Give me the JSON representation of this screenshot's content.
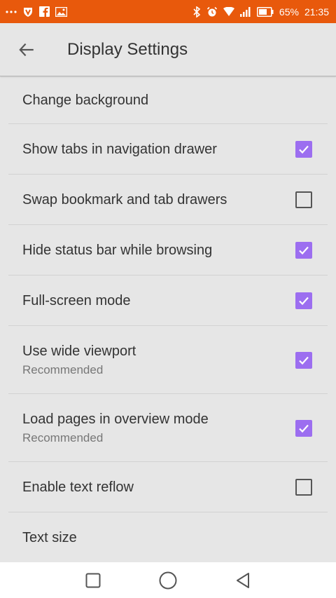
{
  "status_bar": {
    "battery": "65%",
    "time": "21:35",
    "icons": [
      "more-icon",
      "vpn-shield-icon",
      "facebook-icon",
      "image-icon",
      "bluetooth-icon",
      "alarm-icon",
      "wifi-icon",
      "signal-icon",
      "battery-icon"
    ]
  },
  "app_bar": {
    "title": "Display Settings",
    "back_icon": "arrow-left-icon"
  },
  "settings": [
    {
      "title": "Change background",
      "subtitle": "",
      "checkbox": null
    },
    {
      "title": "Show tabs in navigation drawer",
      "subtitle": "",
      "checkbox": true
    },
    {
      "title": "Swap bookmark and tab drawers",
      "subtitle": "",
      "checkbox": false
    },
    {
      "title": "Hide status bar while browsing",
      "subtitle": "",
      "checkbox": true
    },
    {
      "title": "Full-screen mode",
      "subtitle": "",
      "checkbox": true
    },
    {
      "title": "Use wide viewport",
      "subtitle": "Recommended",
      "checkbox": true
    },
    {
      "title": "Load pages in overview mode",
      "subtitle": "Recommended",
      "checkbox": true
    },
    {
      "title": "Enable text reflow",
      "subtitle": "",
      "checkbox": false
    },
    {
      "title": "Text size",
      "subtitle": "",
      "checkbox": null
    }
  ],
  "nav_bar": {
    "icons": [
      "recents-square-icon",
      "home-circle-icon",
      "back-triangle-icon"
    ]
  },
  "colors": {
    "status_bar": "#e8590c",
    "accent": "#9c6ef0",
    "background": "#e6e6e6"
  }
}
